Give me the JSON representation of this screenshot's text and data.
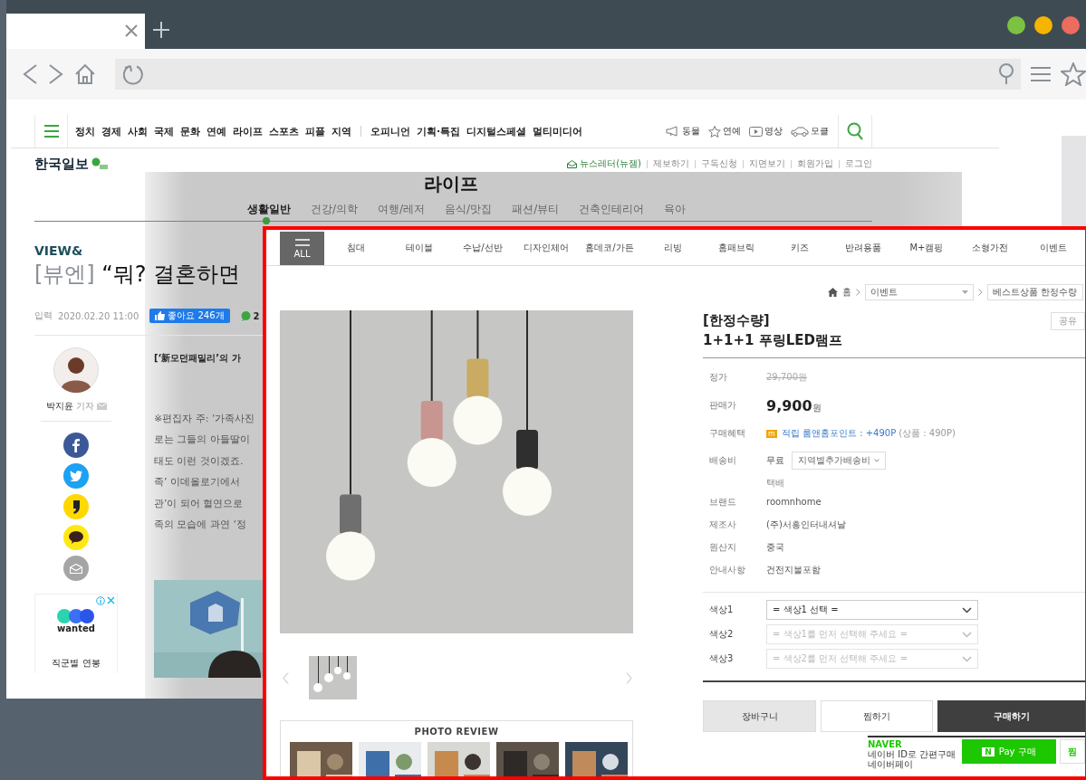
{
  "browser": {
    "traffic_lights": [
      {
        "color": "#7cc242"
      },
      {
        "color": "#f5b400"
      },
      {
        "color": "#ec6c5e"
      }
    ]
  },
  "site": {
    "nav": [
      "정치",
      "경제",
      "사회",
      "국제",
      "문화",
      "연예",
      "라이프",
      "스포츠",
      "피플",
      "지역"
    ],
    "nav_2": [
      "오피니언",
      "기획·특집",
      "디지털스페셜",
      "멀티미디어"
    ],
    "quick_links": [
      {
        "kind": "megaphone",
        "label": "동물"
      },
      {
        "kind": "star",
        "label": "연예"
      },
      {
        "kind": "video",
        "label": "영상"
      },
      {
        "kind": "car",
        "label": "모클"
      }
    ],
    "logo": "한국일보",
    "top_links": [
      {
        "kind": "newsletter",
        "label": "뉴스레터(뉴잼)"
      },
      {
        "kind": "plain",
        "label": "제보하기"
      },
      {
        "kind": "plain",
        "label": "구독신청"
      },
      {
        "kind": "plain",
        "label": "지면보기"
      },
      {
        "kind": "plain",
        "label": "회원가입"
      },
      {
        "kind": "plain",
        "label": "로그인"
      }
    ]
  },
  "section": {
    "title": "라이프",
    "tabs": [
      {
        "label": "생활일반",
        "selected": true
      },
      {
        "label": "건강/의학",
        "selected": false
      },
      {
        "label": "여행/레저",
        "selected": false
      },
      {
        "label": "음식/맛집",
        "selected": false
      },
      {
        "label": "패션/뷰티",
        "selected": false
      },
      {
        "label": "건축인테리어",
        "selected": false
      },
      {
        "label": "육아",
        "selected": false
      }
    ]
  },
  "article": {
    "category": "VIEW&",
    "title_prefix": "[뷰엔]",
    "title": "“뭐? 결혼하면",
    "date_label": "입력",
    "date": "2020.02.20 11:00",
    "likes": "좋아요 246개",
    "comments": "2",
    "author": "박지윤",
    "author_role": "기자",
    "subtitle": "[‘新모던패밀리’의 가",
    "body": [
      "※편집자 주: ‘가족사진",
      "로는 그들의 아들딸이",
      "태도 이런 것이겠죠.",
      "족’ 이데올로기에서",
      "관’이 되어 혈연으로",
      "족의 모습에 과연 ‘정"
    ],
    "share": [
      {
        "kind": "facebook"
      },
      {
        "kind": "twitter"
      },
      {
        "kind": "kakaostory"
      },
      {
        "kind": "kakaotalk"
      },
      {
        "kind": "mail"
      }
    ]
  },
  "ad": {
    "brand": "wanted",
    "text": "직군별 연봉"
  },
  "shop": {
    "all_label": "ALL",
    "categories": [
      "침대",
      "테이블",
      "수납/선반",
      "디자인체어",
      "홈데코/가든",
      "리빙",
      "홈패브릭",
      "키즈",
      "반려용품",
      "M+캠핑",
      "소형가전",
      "이벤트"
    ],
    "breadcrumb": {
      "home": "홈",
      "level_1": "이벤트",
      "level_2": "베스트상품 한정수량"
    },
    "photo_review": "PHOTO REVIEW",
    "product": {
      "title_1": "[한정수량]",
      "title_2": "1+1+1 푸링LED램프",
      "share": "공유",
      "rows": [
        {
          "kind": "strike",
          "label": "정가",
          "value": "29,700원"
        },
        {
          "kind": "price",
          "label": "판매가",
          "value": "9,900",
          "unit": "원"
        },
        {
          "kind": "points",
          "label": "구매혜택",
          "badge": "m",
          "value": "적립 룸앤홈포인트 : +490P",
          "note": "(상품 : 490P)"
        },
        {
          "kind": "shipping",
          "label": "배송비",
          "value": "무료",
          "option": "지역별추가배송비",
          "note": "택배"
        },
        {
          "kind": "plain",
          "label": "브랜드",
          "value": "roomnhome"
        },
        {
          "kind": "plain",
          "label": "제조사",
          "value": "(주)서흥인터내셔날"
        },
        {
          "kind": "plain",
          "label": "원산지",
          "value": "중국"
        },
        {
          "kind": "plain",
          "label": "안내사항",
          "value": "건전지불포함"
        }
      ],
      "options": [
        {
          "label": "색상1",
          "value": "= 색상1 선택 =",
          "disabled": false
        },
        {
          "label": "색상2",
          "value": "= 색상1를 먼저 선택해 주세요 =",
          "disabled": true
        },
        {
          "label": "색상3",
          "value": "= 색상2를 먼저 선택해 주세요 =",
          "disabled": true
        }
      ],
      "buttons": [
        {
          "kind": "cart",
          "label": "장바구니"
        },
        {
          "kind": "wish",
          "label": "찜하기"
        },
        {
          "kind": "buy",
          "label": "구매하기"
        }
      ],
      "naver": {
        "brand": "NAVER",
        "line_1": "네이버 ID로 간편구매",
        "line_2": "네이버페이",
        "badge": "N",
        "pay": "Pay 구매",
        "wish": "찜"
      }
    }
  }
}
